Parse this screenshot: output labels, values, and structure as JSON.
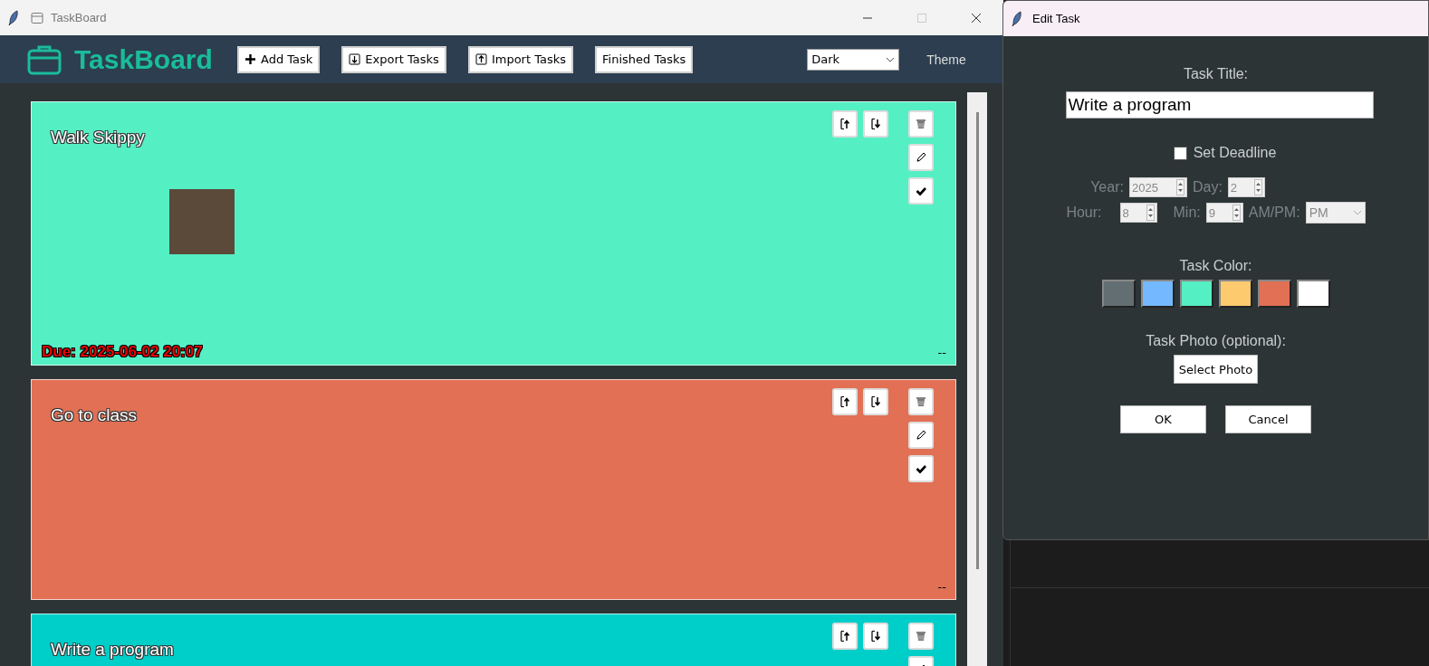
{
  "main_window": {
    "title": "TaskBoard",
    "app_name": "TaskBoard",
    "toolbar": [
      {
        "label": "Add Task",
        "kind": "plus"
      },
      {
        "label": "Export Tasks",
        "kind": "down"
      },
      {
        "label": "Import Tasks",
        "kind": "up"
      },
      {
        "label": "Finished Tasks",
        "kind": "text"
      }
    ],
    "theme_select": {
      "value": "Dark"
    },
    "theme_label": "Theme"
  },
  "tasks": [
    {
      "title": "Walk Skippy",
      "color": "#55efc4",
      "photo": true,
      "due": "Due: 2025-06-02 20:07",
      "footer": "--"
    },
    {
      "title": "Go to class",
      "color": "#e17055",
      "photo": false,
      "footer": "--"
    },
    {
      "title": "Write a program",
      "color": "#00cec9"
    }
  ],
  "dialog": {
    "title": "Edit Task",
    "title_label": "Task Title:",
    "title_value": "Write a program",
    "deadline": {
      "label": "Set Deadline",
      "checked": false
    },
    "field_rows": [
      [
        {
          "label": "Year:",
          "value": "2025",
          "kind": "spin",
          "disabled": true
        },
        {
          "label": "Day:",
          "value": "2",
          "kind": "spin",
          "disabled": true
        }
      ],
      [
        {
          "label": "Hour:",
          "value": "8",
          "kind": "spin",
          "disabled": true
        },
        {
          "label": "Min:",
          "value": "9",
          "kind": "spin",
          "disabled": true
        },
        {
          "label": "AM/PM:",
          "value": "PM",
          "kind": "select",
          "disabled": true
        }
      ]
    ],
    "color_label": "Task Color:",
    "swatches": [
      {
        "color": "#636e72"
      },
      {
        "color": "#74b9ff"
      },
      {
        "color": "#55efc4"
      },
      {
        "color": "#fdcb6e"
      },
      {
        "color": "#e17055"
      },
      {
        "color": "#ffffff"
      }
    ],
    "photo_label": "Task Photo (optional):",
    "photo_button": "Select Photo",
    "buttons": [
      "OK",
      "Cancel"
    ]
  }
}
